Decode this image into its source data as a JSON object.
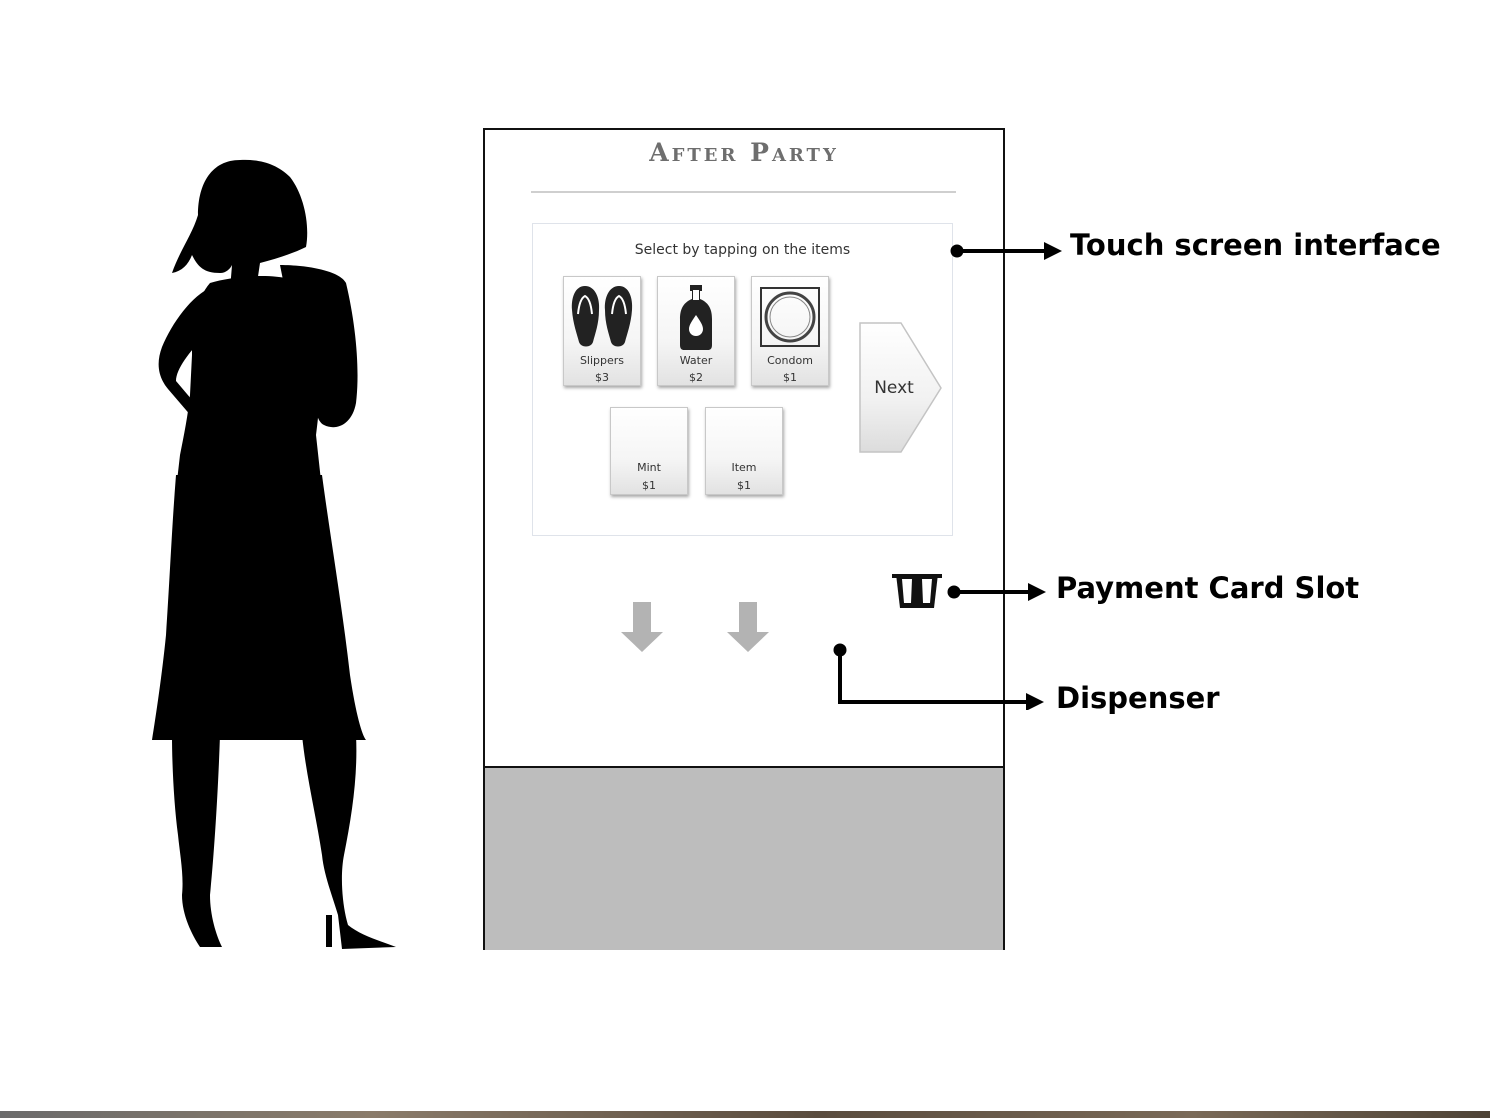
{
  "kiosk": {
    "title": "After Party",
    "prompt": "Select by tapping on the items",
    "items": [
      {
        "label": "Slippers",
        "price": "$3",
        "icon": "flip-flops-icon"
      },
      {
        "label": "Water",
        "price": "$2",
        "icon": "water-bottle-icon"
      },
      {
        "label": "Condom",
        "price": "$1",
        "icon": "condom-icon"
      },
      {
        "label": "Mint",
        "price": "$1",
        "icon": ""
      },
      {
        "label": "Item",
        "price": "$1",
        "icon": ""
      }
    ],
    "next_label": "Next",
    "colors": {
      "base": "#bdbdbd",
      "arrow": "#b3b3b3",
      "title": "#6e6e6e"
    }
  },
  "callouts": {
    "touch_screen": "Touch screen interface",
    "payment_slot": "Payment Card Slot",
    "dispenser": "Dispenser"
  }
}
